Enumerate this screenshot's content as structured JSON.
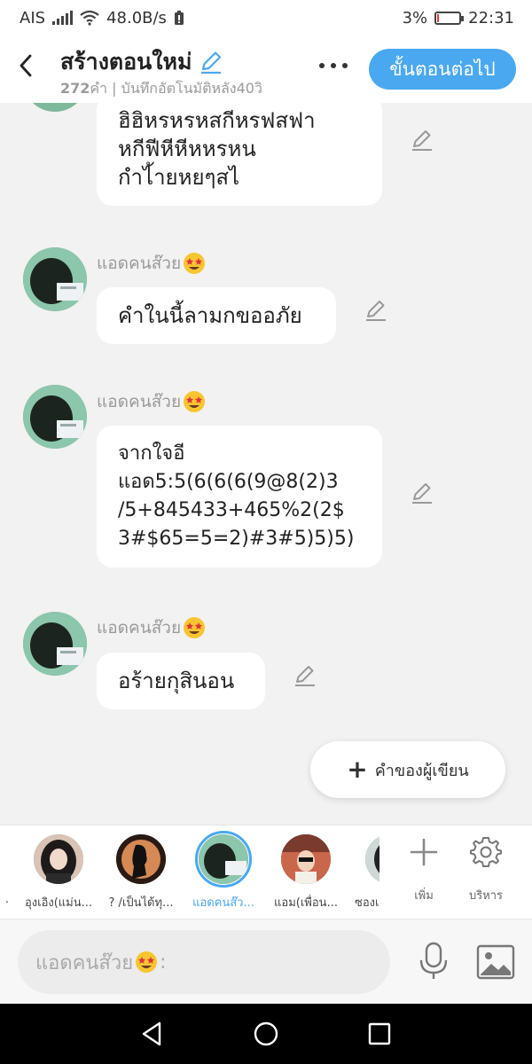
{
  "status": {
    "carrier": "AIS",
    "speed": "48.0B/s",
    "battery": "3%",
    "time": "22:31",
    "battery_level": 0.03
  },
  "header": {
    "title": "สร้างตอนใหม่",
    "word_count": "272",
    "subtitle_rest": "คำ | บันทึกอัตโนมัติหลัง40วิ",
    "next_label": "ขั้นตอนต่อไป"
  },
  "messages": [
    {
      "author": "",
      "text": "ฮิฮิหรหรหสกีหรฟสฟา\nหกีฟีหีหีหหรหน\nกำไ้ายหยๆสไ"
    },
    {
      "author": "แอดคนส๊วย",
      "text": "คำในนี้ลามกขออภัย"
    },
    {
      "author": "แอดคนส๊วย",
      "text": "จากใจอี\nแอด5:5(6(6(6(9@8(2)3\n/5+845433+465%2(2$\n3#$65=5=2)#3#5)5)5)"
    },
    {
      "author": "แอดคนส๊วย",
      "text": "อร้ายกุสินอน"
    }
  ],
  "writer_button": "คำของผู้เขียน",
  "characters": [
    {
      "name": "."
    },
    {
      "name": "อุงเอิง(แม่น..."
    },
    {
      "name": "? /เป็นได้ทุ..."
    },
    {
      "name": "แอดคนส๊ว..."
    },
    {
      "name": "แอม(เพื่อน..."
    },
    {
      "name": "ซองเ"
    }
  ],
  "tools": {
    "add": "เพิ่ม",
    "manage": "บริหาร"
  },
  "composer": {
    "placeholder": "แอดคนส๊วย",
    "suffix": ":"
  },
  "colors": {
    "accent": "#4aa8f0",
    "background": "#f2f2f2"
  }
}
